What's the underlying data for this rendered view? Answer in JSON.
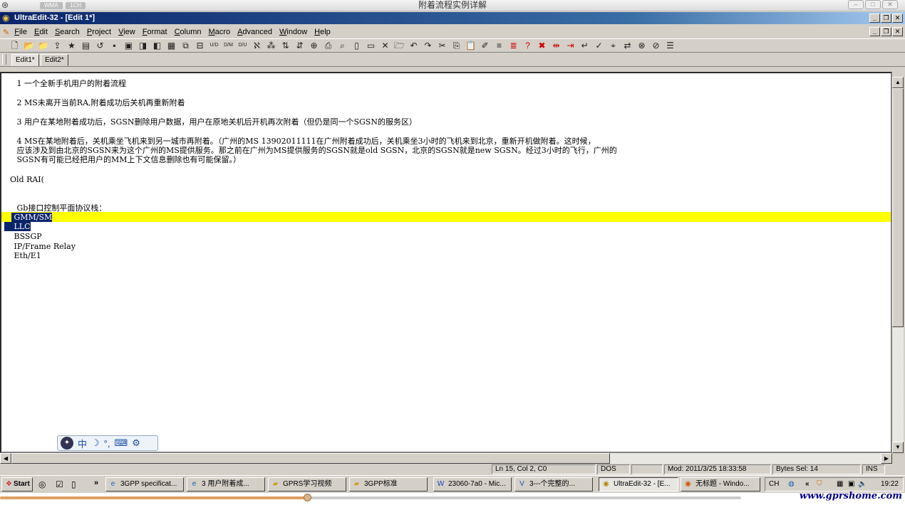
{
  "player": {
    "title": "附着流程实例详解",
    "pills": [
      "WMA",
      "1CH"
    ]
  },
  "app": {
    "window_title": "UltraEdit-32 - [Edit 1*]"
  },
  "menu": [
    "File",
    "Edit",
    "Search",
    "Project",
    "View",
    "Format",
    "Column",
    "Macro",
    "Advanced",
    "Window",
    "Help"
  ],
  "toolbar_icons": [
    "new-file-icon",
    "open-icon",
    "open-folder-icon",
    "open-ftp-icon",
    "favorites-icon",
    "quick-open-icon",
    "revert-icon",
    "save-icon",
    "save-all-icon",
    "save-as-icon",
    "save-ftp-icon",
    "print-preview-icon",
    "copy-file-icon",
    "toggle-icon",
    "unix-dos-icon",
    "dos-mac-icon",
    "dos-unix-icon",
    "convert-icon",
    "ascii-icon",
    "sort-asc-icon",
    "sort-desc-icon",
    "insert-icon",
    "print-icon",
    "preview-icon",
    "page-setup-icon",
    "print-setup-icon",
    "close-icon",
    "open-folder2-icon",
    "undo-icon",
    "redo-icon",
    "cut-icon",
    "copy-icon",
    "paste-icon",
    "clipboard-icon",
    "list-icon",
    "function-list-icon",
    "help-icon",
    "delete-icon",
    "bookmark-icon",
    "next-bookmark-icon",
    "word-wrap-icon",
    "spell-icon",
    "find-icon",
    "replace-icon",
    "find-in-files-icon",
    "replace-in-files-icon",
    "more-icon"
  ],
  "tabs": [
    "Edit1*",
    "Edit2*"
  ],
  "editor": {
    "lines": [
      " 1 一个全新手机用户的附着流程",
      " 2 MS未离开当前RA,附着成功后关机再重新附着",
      " 3 用户在某地附着成功后，SGSN删除用户数据，用户在原地关机后开机再次附着（但仍是同一个SGSN的服务区）",
      " 4 MS在某地附着后，关机乘坐飞机来到另一城市再附着。（广州的MS 13902011111在广州附着成功后，关机乘坐3小时的飞机来到北京，重新开机做附着。这时候，",
      " 应该涉及到由北京的SGSN来为这个广州的MS提供服务。那之前在广州为MS提供服务的SGSN就是old SGSN，北京的SGSN就是new SGSN。经过3小时的飞行，广州的",
      " SGSN有可能已经把用户的MM上下文信息删除也有可能保留。）",
      "Old RAI(",
      " Gb接口控制平面协议栈：",
      " GMM/SM",
      " LLC",
      " BSSGP",
      " IP/Frame Relay",
      " Eth/E1"
    ]
  },
  "status": {
    "position": "Ln 15, Col 2, C0",
    "format": "DOS",
    "modified": "Mod: 2011/3/25 18:33:58",
    "bytes_sel": "Bytes Sel: 14",
    "mode": "INS"
  },
  "ime": {
    "label": "中",
    "icons": [
      "ime-logo-icon",
      "moon-icon",
      "punctuation-icon",
      "keyboard-icon",
      "settings-icon"
    ]
  },
  "taskbar": {
    "start": "Start",
    "tasks": [
      {
        "label": "3GPP specificat...",
        "icon": "ie-icon"
      },
      {
        "label": "3 用户附着成...",
        "icon": "ie-icon"
      },
      {
        "label": "GPRS学习视频",
        "icon": "folder-icon"
      },
      {
        "label": "3GPP标准",
        "icon": "folder-icon"
      },
      {
        "label": "23060-7a0 - Mic...",
        "icon": "word-icon"
      },
      {
        "label": "3---个完整的...",
        "icon": "visio-icon"
      },
      {
        "label": "UltraEdit-32 - [E...",
        "icon": "ultraedit-icon"
      },
      {
        "label": "无标题 - Windo...",
        "icon": "media-icon"
      }
    ],
    "tray": {
      "lang": "CH",
      "time": "19:22"
    }
  },
  "progress": {
    "fraction": 0.415
  },
  "watermark": "www.gprshome.com"
}
